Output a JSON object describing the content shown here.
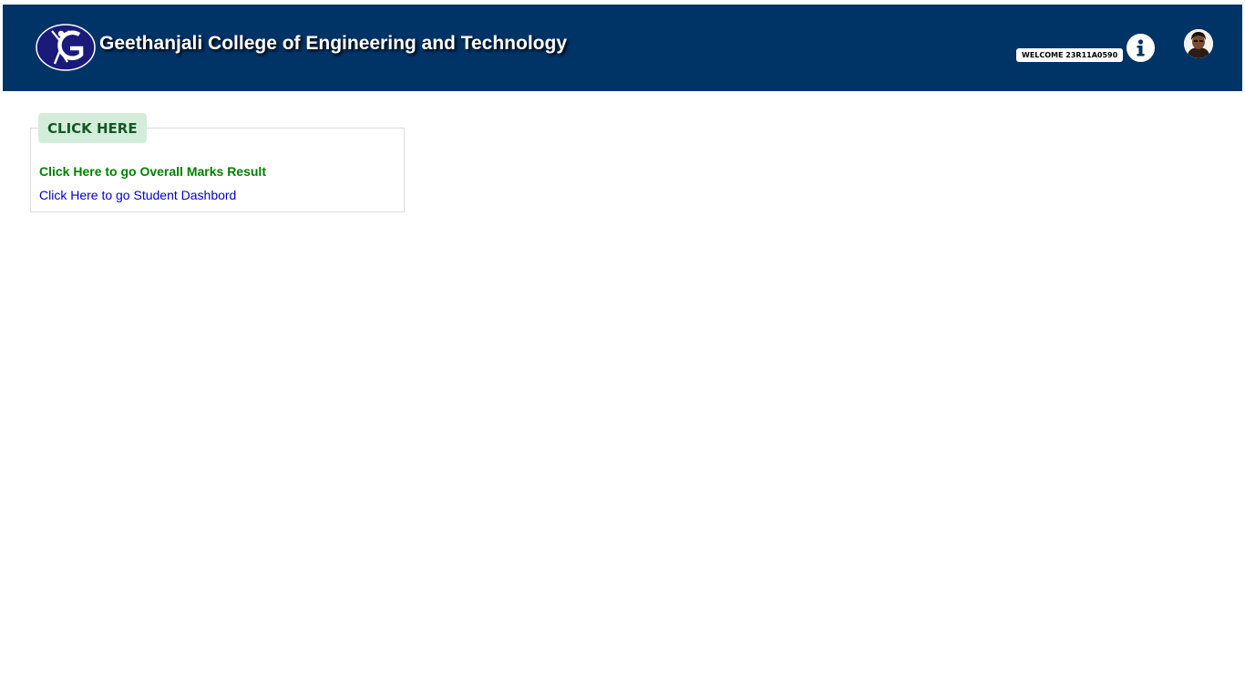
{
  "header": {
    "college_name": "Geethanjali College of Engineering and Technology",
    "welcome_text": "WELCOME 23R11A0590",
    "colors": {
      "header_bg": "#003366",
      "logo_blue": "#1a1a7a"
    },
    "icons": {
      "logo": "college-logo",
      "info": "info-icon",
      "avatar": "user-avatar"
    }
  },
  "panel": {
    "legend": "CLICK HERE",
    "links": {
      "marks": "Click Here to go Overall Marks Result",
      "dashboard": "Click Here to go Student Dashbord"
    },
    "colors": {
      "legend_bg": "#d4edda",
      "legend_text": "#155724",
      "marks_link": "#008000",
      "dashboard_link": "#0000cc"
    }
  }
}
